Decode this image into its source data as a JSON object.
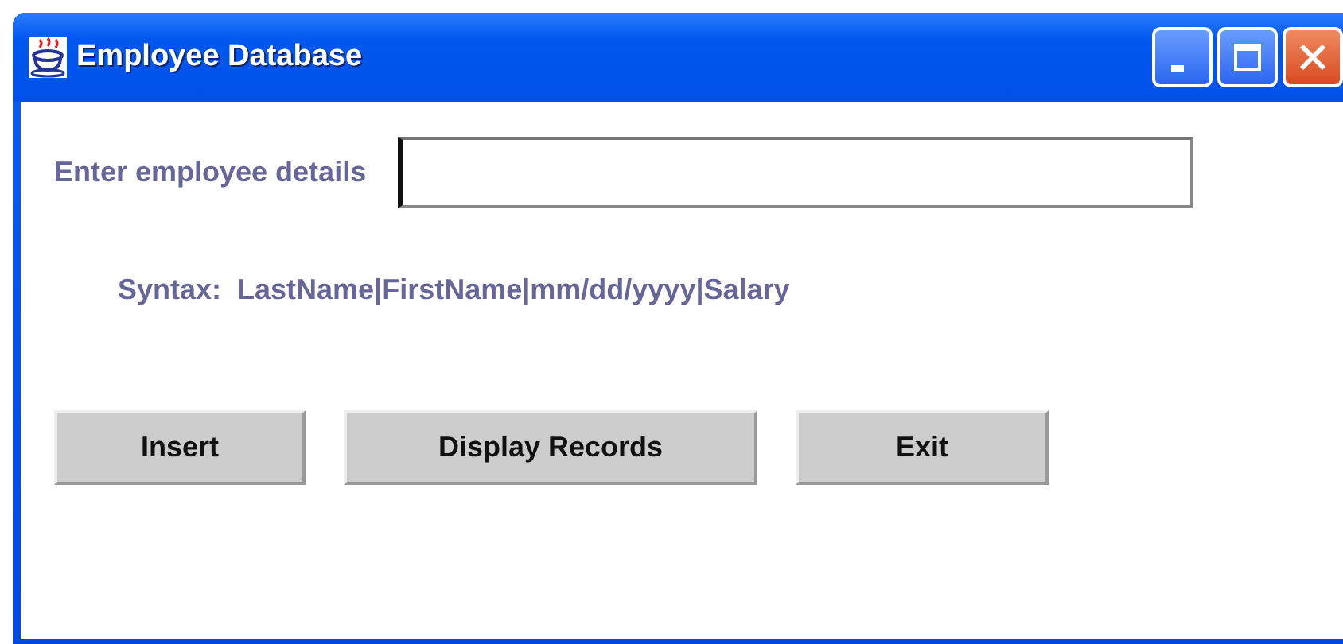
{
  "window": {
    "title": "Employee Database"
  },
  "field": {
    "label": "Enter employee details",
    "focused": true
  },
  "syntax": "Syntax:  LastName|FirstName|mm/dd/yyyy|Salary",
  "buttons": [
    {
      "label": "Insert"
    },
    {
      "label": "Display Records"
    },
    {
      "label": "Exit"
    }
  ]
}
